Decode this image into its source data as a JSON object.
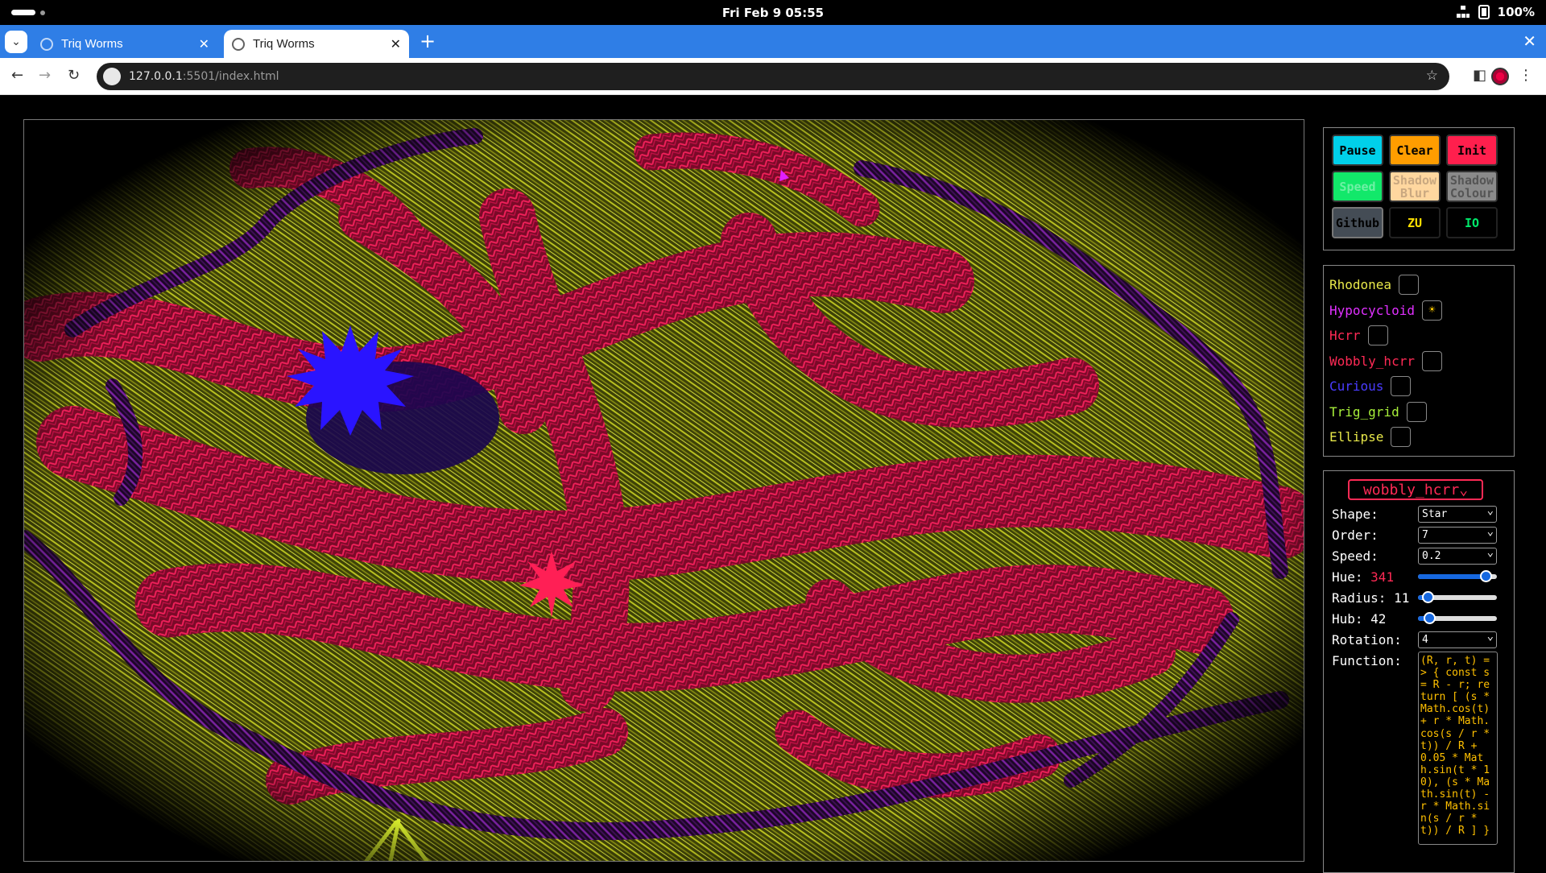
{
  "os": {
    "clock": "Fri Feb 9  05:55",
    "battery": "100%"
  },
  "browser": {
    "tabs": [
      {
        "title": "Triq Worms",
        "active": false
      },
      {
        "title": "Triq Worms",
        "active": true
      }
    ],
    "url_host": "127.0.0.1",
    "url_path": ":5501/index.html"
  },
  "controls": {
    "buttons": [
      {
        "label": "Pause"
      },
      {
        "label": "Clear"
      },
      {
        "label": "Init"
      },
      {
        "label": "Speed"
      },
      {
        "label": "Shadow Blur"
      },
      {
        "label": "Shadow Colour"
      },
      {
        "label": "Github"
      },
      {
        "label": "ZU"
      },
      {
        "label": "IO"
      }
    ]
  },
  "curves": [
    {
      "label": "Rhodonea",
      "color": "#e8e84a",
      "checked": false
    },
    {
      "label": "Hypocycloid",
      "color": "#e030ff",
      "checked": true
    },
    {
      "label": "Hcrr",
      "color": "#ff2a55",
      "checked": false
    },
    {
      "label": "Wobbly_hcrr",
      "color": "#ff2a55",
      "checked": false
    },
    {
      "label": "Curious",
      "color": "#4a3cff",
      "checked": false
    },
    {
      "label": "Trig_grid",
      "color": "#a8f03a",
      "checked": false
    },
    {
      "label": "Ellipse",
      "color": "#e8e84a",
      "checked": false
    }
  ],
  "props": {
    "selected_curve": "wobbly_hcrr",
    "shape_label": "Shape:",
    "shape_value": "Star",
    "order_label": "Order:",
    "order_value": "7",
    "speed_label": "Speed:",
    "speed_value": "0.2",
    "hue_label": "Hue:",
    "hue_value": "341",
    "radius_label": "Radius:",
    "radius_value": "11",
    "hub_label": "Hub:",
    "hub_value": "42",
    "rotation_label": "Rotation:",
    "rotation_value": "4",
    "function_label": "Function:",
    "function_value": "(R, r, t) => { const s = R - r; return [ (s * Math.cos(t) + r * Math.cos(s / r * t)) / R + 0.05 * Math.sin(t * 10), (s * Math.sin(t) - r * Math.sin(s / r * t)) / R ] }",
    "hue_slider_fraction": 0.93,
    "radius_slider_fraction": 0.06,
    "hub_slider_fraction": 0.09
  },
  "colors": {
    "browser_blue": "#2f7ee6",
    "olive_worm": "#a8b020",
    "pink_worm": "#e0144e",
    "purple_worm": "#6a1a8a",
    "blue_star": "#2a14ff"
  }
}
